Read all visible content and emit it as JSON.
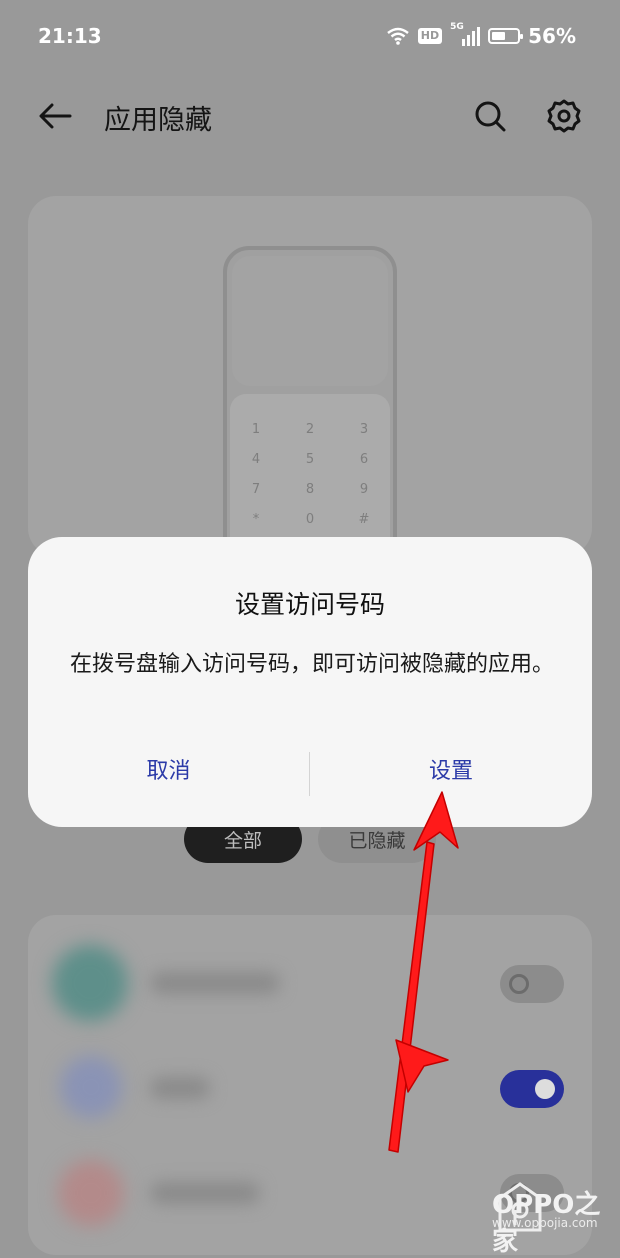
{
  "status_bar": {
    "time": "21:13",
    "hd_badge": "HD",
    "network": "5G",
    "battery_percent": "56%",
    "battery_level": 0.56
  },
  "header": {
    "title": "应用隐藏",
    "back_icon": "back-arrow-icon",
    "search_icon": "search-icon",
    "settings_icon": "gear-icon"
  },
  "dialpad": {
    "keys": [
      "1",
      "2",
      "3",
      "4",
      "5",
      "6",
      "7",
      "8",
      "9",
      "*",
      "0",
      "#"
    ]
  },
  "filter_chips": {
    "all": "全部",
    "hidden": "已隐藏",
    "selected": "全部"
  },
  "app_list": {
    "toggles": [
      false,
      true,
      false
    ]
  },
  "dialog": {
    "title": "设置访问号码",
    "message": "在拨号盘输入访问号码，即可访问被隐藏的应用。",
    "cancel_label": "取消",
    "confirm_label": "设置"
  },
  "watermark": {
    "brand": "OPPO之家",
    "url": "www.oppojia.com"
  },
  "colors": {
    "accent": "#2b3aa8",
    "toggle_on": "#28309a",
    "arrow": "#ff1a1a"
  }
}
